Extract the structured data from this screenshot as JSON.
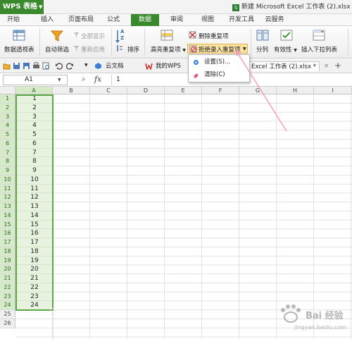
{
  "titlebar": {
    "app_name": "WPS 表格",
    "doc_title": "新建 Microsoft Excel 工作表 (2).xlsx *",
    "excel_icon_letter": "S"
  },
  "menu": {
    "tabs": [
      "开始",
      "插入",
      "页面布局",
      "公式",
      "数据",
      "审阅",
      "视图",
      "开发工具",
      "云服务"
    ],
    "active": "数据"
  },
  "ribbon": {
    "pivot": "数据透视表",
    "autofilter": "自动筛选",
    "show_all": "全部显示",
    "reapply": "重新应用",
    "sort": "排序",
    "sort_glyph_top": "A",
    "sort_glyph_bottom": "Z",
    "highlight_dup": "高亮重复项",
    "delete_dup": "删除重复项",
    "reject_dup": "拒绝录入重复项",
    "split": "分列",
    "validity": "有效性",
    "insert_dropdown": "插入下拉列表"
  },
  "dropdown": {
    "items": [
      "设置(S)...",
      "清除(C)"
    ]
  },
  "quickbar": {
    "tabs": [
      "云文档",
      "我的WPS",
      "Excel 工作表 (2).xlsx *"
    ],
    "plus": "+"
  },
  "formula": {
    "cell_ref": "A1",
    "fx": "fx",
    "value": "1"
  },
  "grid": {
    "columns": [
      "A",
      "B",
      "C",
      "D",
      "E",
      "F",
      "G",
      "H",
      "I"
    ],
    "rows": [
      "1",
      "2",
      "3",
      "4",
      "5",
      "6",
      "7",
      "8",
      "9",
      "10",
      "11",
      "12",
      "13",
      "14",
      "15",
      "16",
      "17",
      "18",
      "19",
      "20",
      "21",
      "22",
      "23",
      "24",
      "25",
      "26"
    ],
    "colA_values": [
      "1",
      "2",
      "3",
      "4",
      "5",
      "6",
      "7",
      "8",
      "9",
      "10",
      "11",
      "12",
      "13",
      "14",
      "15",
      "16",
      "17",
      "18",
      "19",
      "20",
      "21",
      "22",
      "23",
      "24"
    ]
  },
  "watermark": {
    "text": "Bai 经验",
    "sub": "jingyan.baidu.com"
  },
  "colors": {
    "accent": "#3a8a2d",
    "selection": "#5aa845",
    "cell_fill": "#e7f3df",
    "highlight": "#fbe3a6"
  }
}
